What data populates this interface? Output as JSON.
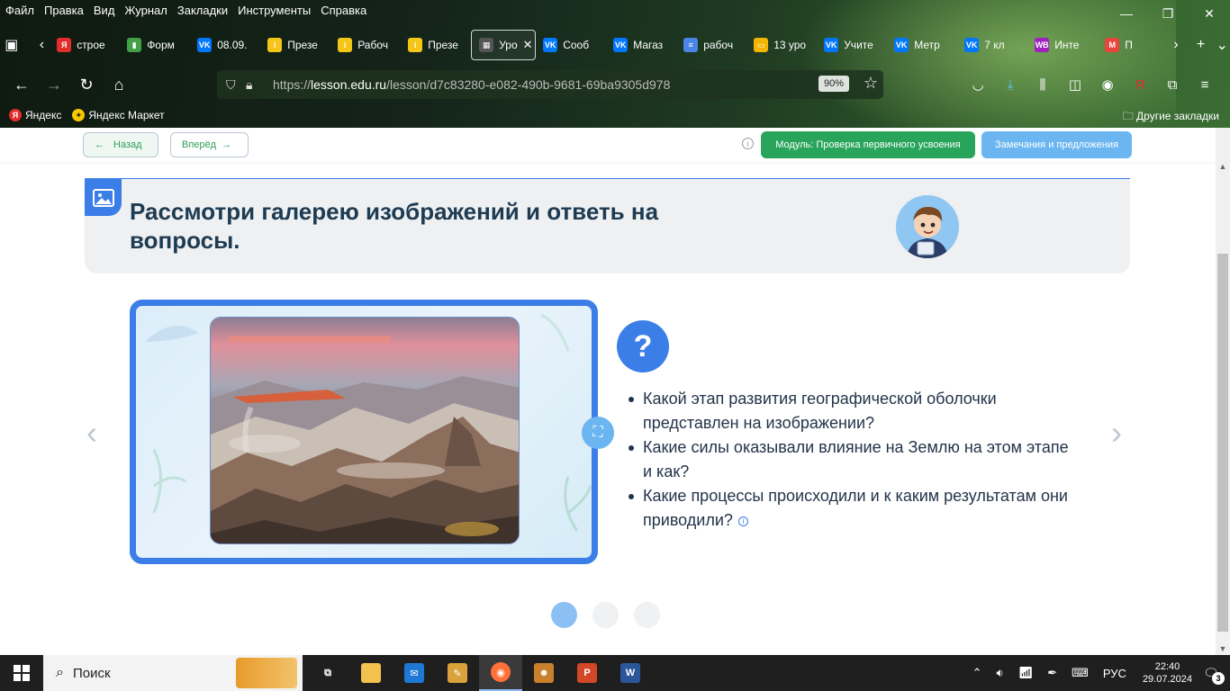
{
  "menu": [
    "Файл",
    "Правка",
    "Вид",
    "Журнал",
    "Закладки",
    "Инструменты",
    "Справка"
  ],
  "tabs": [
    {
      "label": "строе",
      "color": "#e32d2d",
      "glyph": "Я"
    },
    {
      "label": "Форм",
      "color": "#43a047",
      "glyph": "▮"
    },
    {
      "label": "08.09.",
      "color": "#0077ff",
      "glyph": "VK"
    },
    {
      "label": "Презе",
      "color": "#f5c518",
      "glyph": "i"
    },
    {
      "label": "Рабоч",
      "color": "#f5c518",
      "glyph": "i"
    },
    {
      "label": "Презе",
      "color": "#f5c518",
      "glyph": "i"
    },
    {
      "label": "Уро",
      "color": "#555555",
      "glyph": "▦",
      "active": true
    },
    {
      "label": "Сооб",
      "color": "#0077ff",
      "glyph": "VK"
    },
    {
      "label": "Магаз",
      "color": "#0077ff",
      "glyph": "VK"
    },
    {
      "label": "рабоч",
      "color": "#4a86e8",
      "glyph": "≡"
    },
    {
      "label": "13 уро",
      "color": "#f4b400",
      "glyph": "▭"
    },
    {
      "label": "Учите",
      "color": "#0077ff",
      "glyph": "VK"
    },
    {
      "label": "Метр",
      "color": "#0077ff",
      "glyph": "VK"
    },
    {
      "label": "7 кл",
      "color": "#0077ff",
      "glyph": "VK"
    },
    {
      "label": "Инте",
      "color": "#a020c0",
      "glyph": "WB"
    },
    {
      "label": "П",
      "color": "#e8453c",
      "glyph": "M"
    }
  ],
  "address": {
    "prefix": "https://",
    "host": "lesson.edu.ru",
    "path": "/lesson/d7c83280-e082-490b-9681-69ba9305d978",
    "zoom": "90%"
  },
  "bookmarks": [
    {
      "label": "Яндекс",
      "color": "#e32d2d",
      "glyph": "Я"
    },
    {
      "label": "Яндекс Маркет",
      "color": "#f6c700",
      "glyph": "✦"
    }
  ],
  "bookmarks_other": "Другие закладки",
  "page": {
    "back": "Назад",
    "forward": "Вперёд",
    "module": "Модуль: Проверка первичного усвоения",
    "feedback": "Замечания и предложения",
    "task_title": "Рассмотри галерею изображений и ответь на вопросы.",
    "questions": [
      "Какой этап развития географической оболочки представлен на изображении?",
      "Какие силы оказывали влияние на Землю на этом этапе и как?",
      "Какие процессы происходили и к каким результатам они приводили?"
    ],
    "q_mark": "?",
    "slides": 3,
    "active_slide": 1
  },
  "taskbar": {
    "search": "Поиск",
    "lang": "РУС",
    "time": "22:40",
    "date": "29.07.2024",
    "notifications": "3"
  }
}
